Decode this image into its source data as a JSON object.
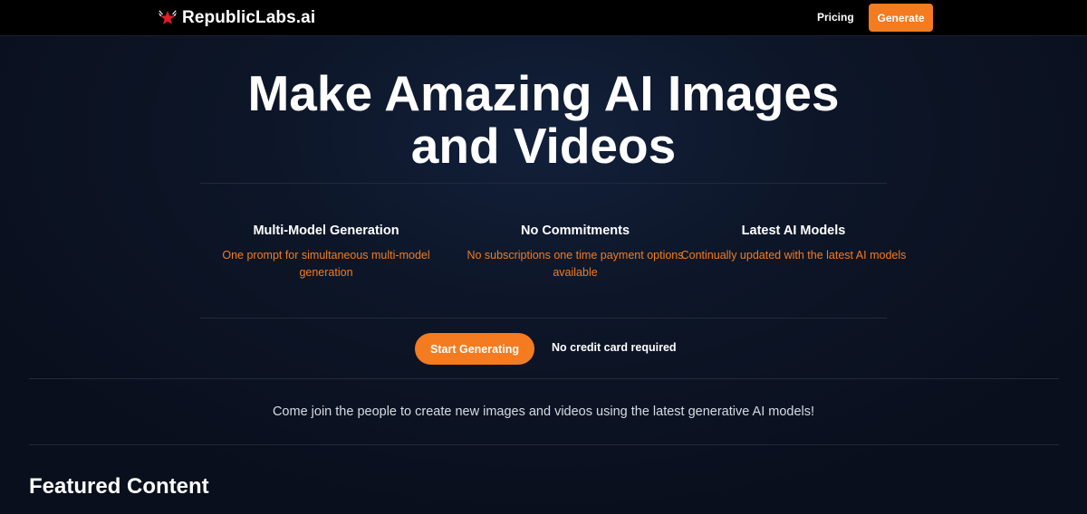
{
  "nav": {
    "logo_text": "RepublicLabs.ai",
    "logo_icon": "star-wings-logo-icon",
    "pricing_label": "Pricing",
    "generate_label": "Generate"
  },
  "hero": {
    "title_line1": "Make Amazing AI Images",
    "title_line2": "and Videos"
  },
  "features": [
    {
      "title": "Multi-Model Generation",
      "description": "One prompt for simultaneous multi-model generation"
    },
    {
      "title": "No Commitments",
      "description": "No subscriptions one time payment options available"
    },
    {
      "title": "Latest AI Models",
      "description": "Continually updated with the latest AI models"
    }
  ],
  "cta": {
    "button_label": "Start Generating",
    "note": "No credit card required"
  },
  "tagline": "Come join the people to create new images and videos using the latest generative AI models!",
  "featured": {
    "heading": "Featured Content"
  },
  "colors": {
    "accent": "#f47b20",
    "background": "#0b1120",
    "nav_background": "#000000",
    "logo_icon": "#e11d2a"
  }
}
